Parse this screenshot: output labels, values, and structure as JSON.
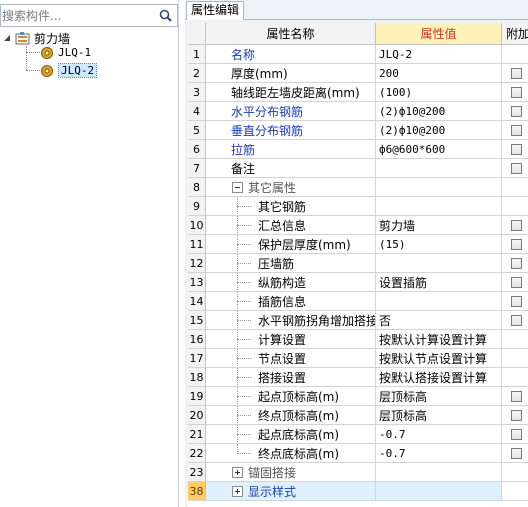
{
  "search": {
    "placeholder": "搜索构件..."
  },
  "tree": {
    "root_label": "剪力墙",
    "children": [
      {
        "label": "JLQ-1"
      },
      {
        "label": "JLQ-2"
      }
    ],
    "selected_index": 1
  },
  "tabs": [
    {
      "label": "属性编辑"
    }
  ],
  "grid": {
    "headers": {
      "name": "属性名称",
      "value": "属性值",
      "extra": "附加"
    },
    "rows": [
      {
        "num": "1",
        "name": "名称",
        "value": "JLQ-2",
        "checkbox": false,
        "blue": true
      },
      {
        "num": "2",
        "name": "厚度(mm)",
        "value": "200",
        "checkbox": true
      },
      {
        "num": "3",
        "name": "轴线距左墙皮距离(mm)",
        "value": "(100)",
        "checkbox": true
      },
      {
        "num": "4",
        "name": "水平分布钢筋",
        "value": "(2)ф10@200",
        "checkbox": true,
        "blue": true
      },
      {
        "num": "5",
        "name": "垂直分布钢筋",
        "value": "(2)ф10@200",
        "checkbox": true,
        "blue": true
      },
      {
        "num": "6",
        "name": "拉筋",
        "value": "ф6@600*600",
        "checkbox": true,
        "blue": true
      },
      {
        "num": "7",
        "name": "备注",
        "value": "",
        "checkbox": true
      },
      {
        "num": "8",
        "name": "其它属性",
        "value": "",
        "group": true,
        "expanded": true
      },
      {
        "num": "9",
        "name": "其它钢筋",
        "value": "",
        "child": true
      },
      {
        "num": "10",
        "name": "汇总信息",
        "value": "剪力墙",
        "checkbox": true,
        "child": true
      },
      {
        "num": "11",
        "name": "保护层厚度(mm)",
        "value": "(15)",
        "checkbox": true,
        "child": true
      },
      {
        "num": "12",
        "name": "压墙筋",
        "value": "",
        "checkbox": true,
        "child": true
      },
      {
        "num": "13",
        "name": "纵筋构造",
        "value": "设置插筋",
        "checkbox": true,
        "child": true
      },
      {
        "num": "14",
        "name": "插筋信息",
        "value": "",
        "checkbox": true,
        "child": true
      },
      {
        "num": "15",
        "name": "水平钢筋拐角增加搭接",
        "value": "否",
        "checkbox": true,
        "child": true
      },
      {
        "num": "16",
        "name": "计算设置",
        "value": "按默认计算设置计算",
        "child": true
      },
      {
        "num": "17",
        "name": "节点设置",
        "value": "按默认节点设置计算",
        "child": true
      },
      {
        "num": "18",
        "name": "搭接设置",
        "value": "按默认搭接设置计算",
        "child": true
      },
      {
        "num": "19",
        "name": "起点顶标高(m)",
        "value": "层顶标高",
        "checkbox": true,
        "child": true
      },
      {
        "num": "20",
        "name": "终点顶标高(m)",
        "value": "层顶标高",
        "checkbox": true,
        "child": true
      },
      {
        "num": "21",
        "name": "起点底标高(m)",
        "value": "-0.7",
        "checkbox": true,
        "child": true
      },
      {
        "num": "22",
        "name": "终点底标高(m)",
        "value": "-0.7",
        "checkbox": true,
        "child": true
      },
      {
        "num": "23",
        "name": "锚固搭接",
        "value": "",
        "group": true,
        "expanded": false
      },
      {
        "num": "38",
        "name": "显示样式",
        "value": "",
        "group": true,
        "expanded": false,
        "active": true
      }
    ]
  },
  "colors": {
    "header_value_bg": "#fff2b8",
    "header_value_text": "#c0392b",
    "blue_label": "#1a3fb0",
    "active_row_num": "#ffcc66"
  },
  "icons": {
    "search": "search-icon",
    "tree_root": "wall-folder-icon",
    "tree_child": "gear-component-icon"
  }
}
